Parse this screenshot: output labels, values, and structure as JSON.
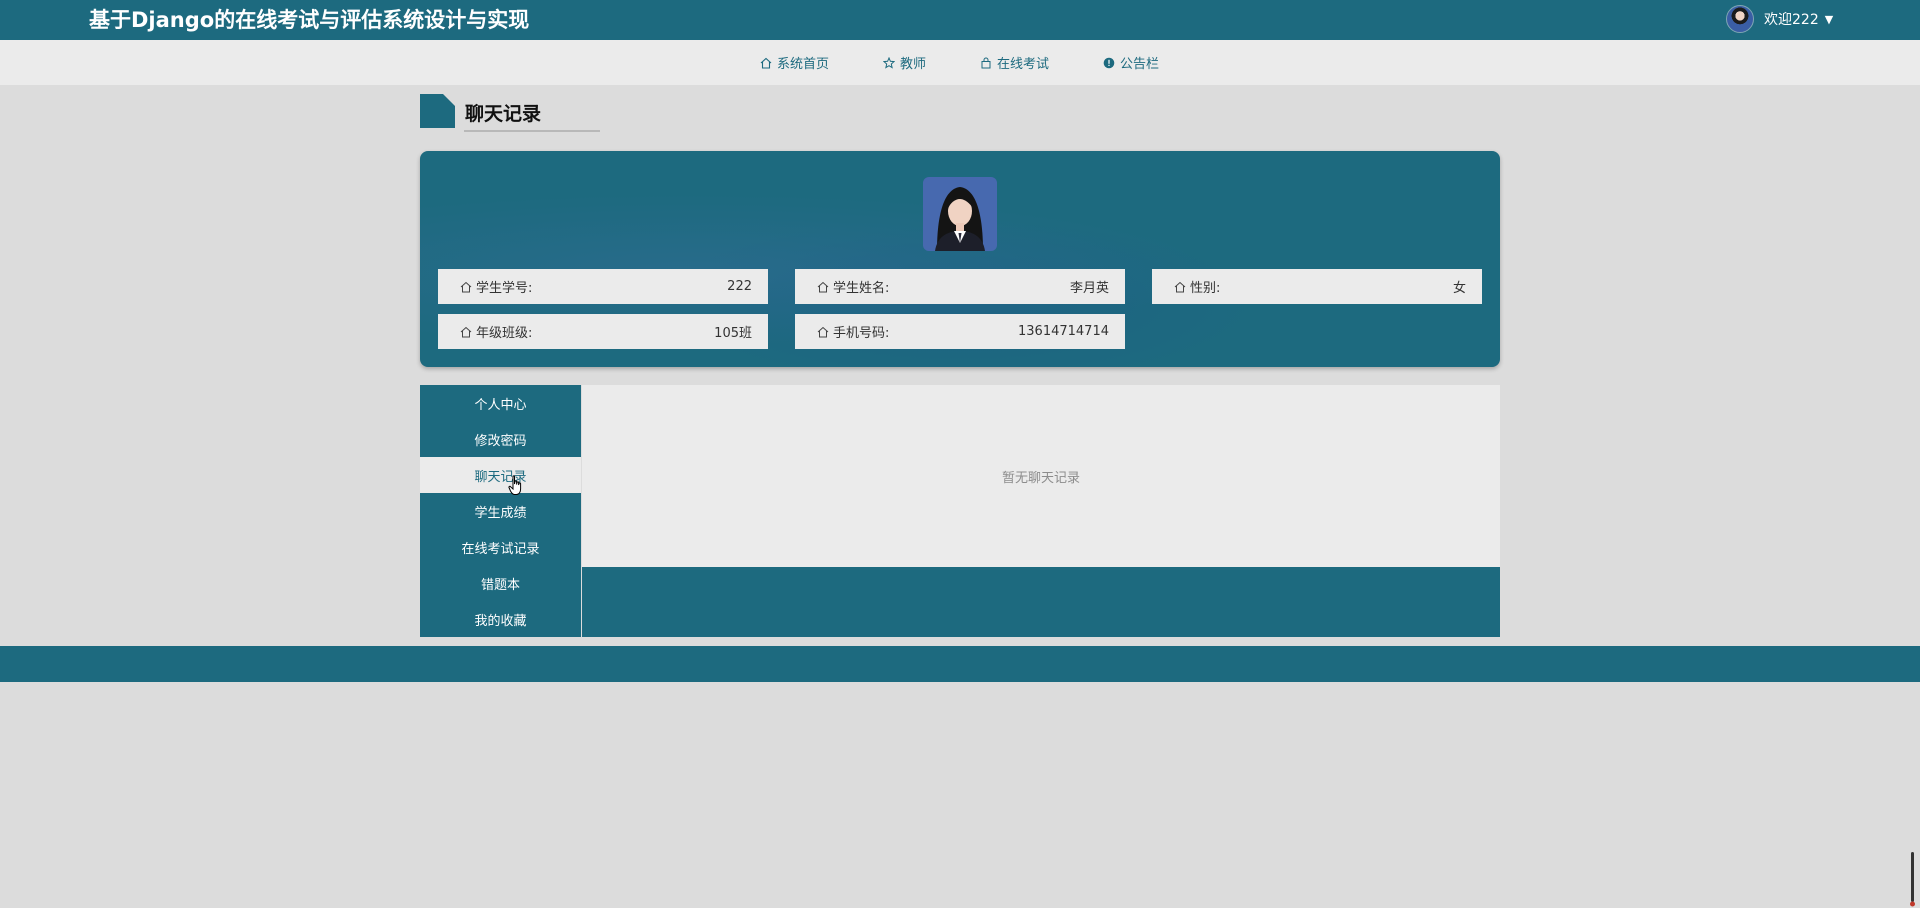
{
  "header": {
    "site_title": "基于Django的在线考试与评估系统设计与实现",
    "user_label": "欢迎222",
    "caret": "▼"
  },
  "nav": {
    "items": [
      {
        "label": "系统首页",
        "icon": "home-icon"
      },
      {
        "label": "教师",
        "icon": "star-icon"
      },
      {
        "label": "在线考试",
        "icon": "bag-icon"
      },
      {
        "label": "公告栏",
        "icon": "info-icon"
      }
    ]
  },
  "page": {
    "title": "聊天记录"
  },
  "profile": {
    "fields": [
      {
        "label": "学生学号:",
        "value": "222"
      },
      {
        "label": "学生姓名:",
        "value": "李月英"
      },
      {
        "label": "性别:",
        "value": "女"
      },
      {
        "label": "年级班级:",
        "value": "105班"
      },
      {
        "label": "手机号码:",
        "value": "13614714714"
      }
    ]
  },
  "sidebar": {
    "items": [
      {
        "label": "个人中心"
      },
      {
        "label": "修改密码"
      },
      {
        "label": "聊天记录"
      },
      {
        "label": "学生成绩"
      },
      {
        "label": "在线考试记录"
      },
      {
        "label": "错题本"
      },
      {
        "label": "我的收藏"
      }
    ],
    "active": "聊天记录"
  },
  "content": {
    "empty_text": "暂无聊天记录"
  },
  "colors": {
    "primary": "#1d6a7f",
    "background": "#dcdcdc",
    "panel": "#ebebeb"
  }
}
